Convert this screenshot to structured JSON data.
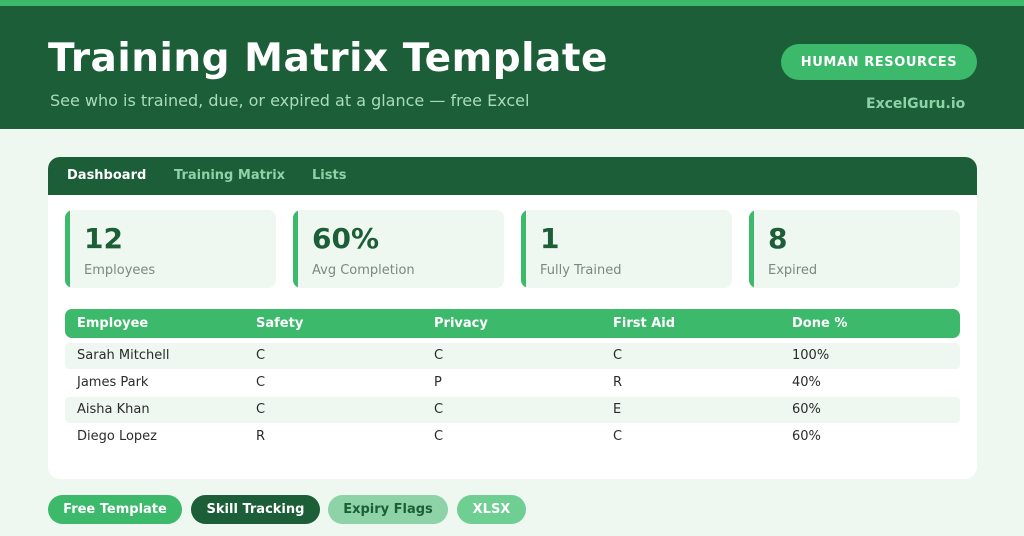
{
  "header": {
    "title": "Training Matrix Template",
    "subtitle": "See who is trained, due, or expired at a glance — free Excel",
    "category_pill": "HUMAN RESOURCES",
    "brand": "ExcelGuru.io"
  },
  "tabs": [
    {
      "label": "Dashboard",
      "active": true
    },
    {
      "label": "Training Matrix",
      "active": false
    },
    {
      "label": "Lists",
      "active": false
    }
  ],
  "stats": [
    {
      "value": "12",
      "label": "Employees"
    },
    {
      "value": "60%",
      "label": "Avg Completion"
    },
    {
      "value": "1",
      "label": "Fully Trained"
    },
    {
      "value": "8",
      "label": "Expired"
    }
  ],
  "table": {
    "columns": [
      "Employee",
      "Safety",
      "Privacy",
      "First Aid",
      "Done %"
    ],
    "rows": [
      [
        "Sarah Mitchell",
        "C",
        "C",
        "C",
        "100%"
      ],
      [
        "James Park",
        "C",
        "P",
        "R",
        "40%"
      ],
      [
        "Aisha Khan",
        "C",
        "C",
        "E",
        "60%"
      ],
      [
        "Diego Lopez",
        "R",
        "C",
        "C",
        "60%"
      ]
    ]
  },
  "tags": [
    "Free Template",
    "Skill Tracking",
    "Expiry Flags",
    "XLSX"
  ],
  "colors": {
    "dark_green": "#1b5e37",
    "accent_green": "#3cb96a",
    "light_green": "#8ed3a8",
    "page_bg": "#eef7f0"
  }
}
